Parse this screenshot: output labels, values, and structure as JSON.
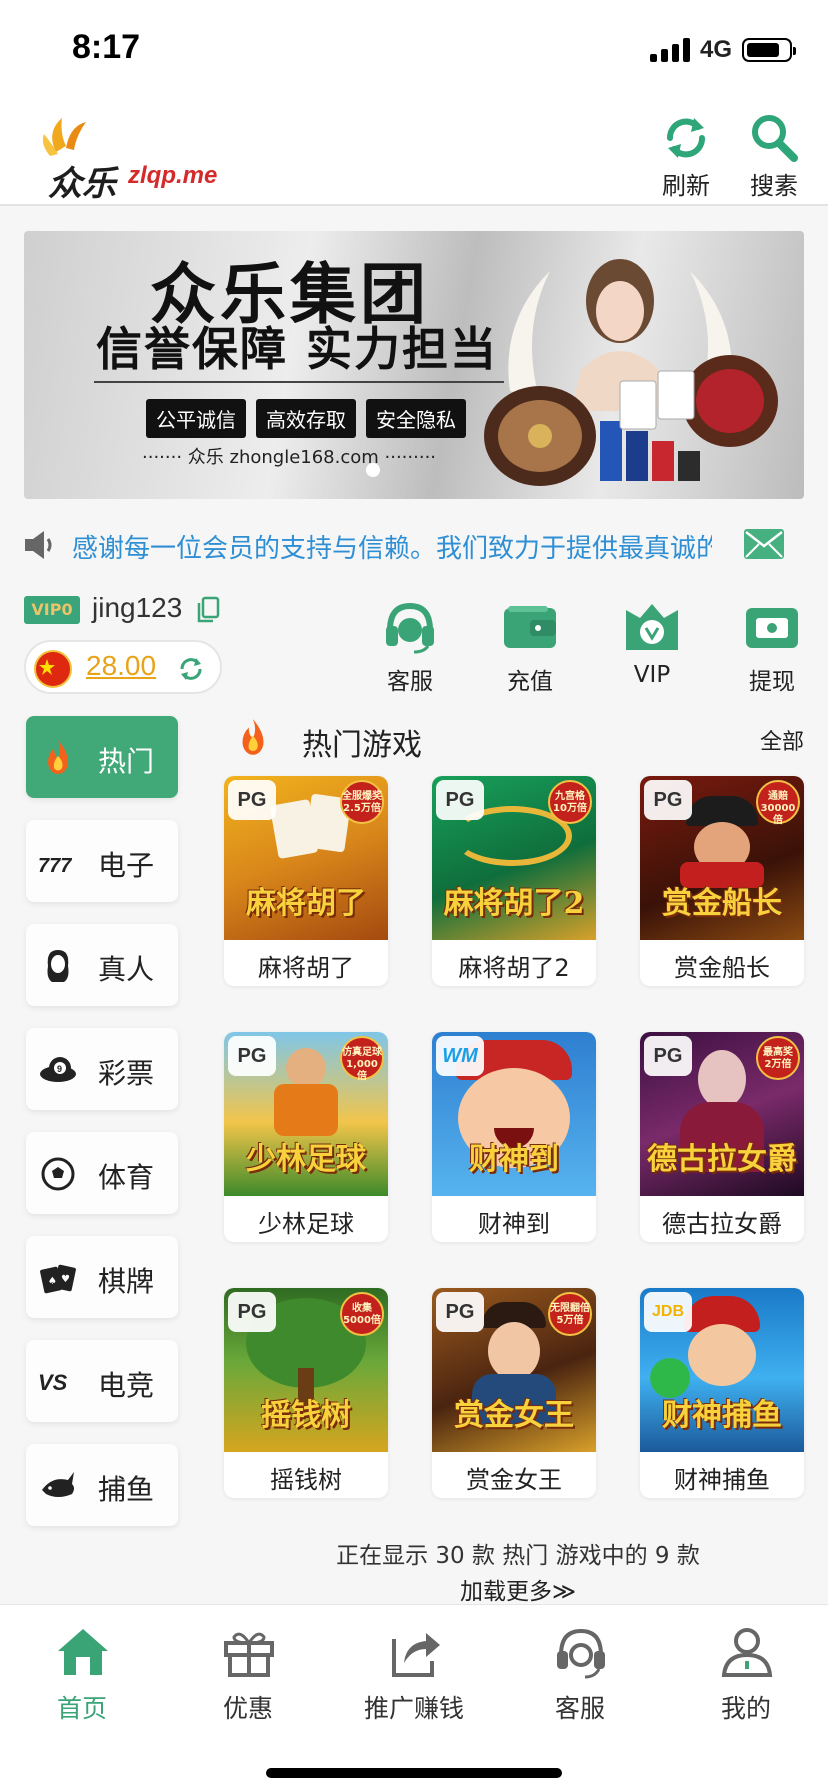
{
  "status_bar": {
    "time": "8:17",
    "network": "4G",
    "battery_fraction": 0.8
  },
  "header": {
    "logo_cn": "众乐",
    "logo_en": "zlqp.me",
    "refresh_label": "刷新",
    "search_label": "搜素"
  },
  "banner": {
    "title": "众乐集团",
    "subtitle": "信誉保障 实力担当",
    "tags": [
      "公平诚信",
      "高效存取",
      "安全隐私"
    ],
    "url": "······· 众乐 zhongle168.com ·········"
  },
  "notice": {
    "text": "感谢每一位会员的支持与信赖。我们致力于提供最真诚的"
  },
  "user": {
    "vip_level": "VIP0",
    "username": "jing123",
    "balance": "28.00"
  },
  "quick_actions": [
    {
      "label": "客服",
      "icon": "headset-icon"
    },
    {
      "label": "充值",
      "icon": "wallet-icon"
    },
    {
      "label": "VIP",
      "icon": "vip-crown-icon"
    },
    {
      "label": "提现",
      "icon": "withdraw-icon"
    }
  ],
  "sidebar": {
    "items": [
      {
        "label": "热门",
        "icon": "fire-icon",
        "active": true
      },
      {
        "label": "电子",
        "icon": "slot-777-icon"
      },
      {
        "label": "真人",
        "icon": "live-dealer-icon"
      },
      {
        "label": "彩票",
        "icon": "lottery-ball-icon"
      },
      {
        "label": "体育",
        "icon": "soccer-ball-icon"
      },
      {
        "label": "棋牌",
        "icon": "playing-cards-icon"
      },
      {
        "label": "电竞",
        "icon": "vs-icon"
      },
      {
        "label": "捕鱼",
        "icon": "shark-icon"
      }
    ]
  },
  "games_section": {
    "title": "热门游戏",
    "all_label": "全部",
    "games": [
      {
        "name": "麻将胡了",
        "provider": "PG",
        "thumb_text": "麻将胡了",
        "badge": "全服爆奖 2.5万倍"
      },
      {
        "name": "麻将胡了2",
        "provider": "PG",
        "thumb_text": "麻将胡了2",
        "badge": "九宫格 10万倍"
      },
      {
        "name": "赏金船长",
        "provider": "PG",
        "thumb_text": "赏金船长",
        "badge": "通赔 30000倍"
      },
      {
        "name": "少林足球",
        "provider": "PG",
        "thumb_text": "少林足球",
        "badge": "仿真足球 1,000倍"
      },
      {
        "name": "财神到",
        "provider": "WM",
        "thumb_text": "财神到",
        "badge": ""
      },
      {
        "name": "德古拉女爵",
        "provider": "PG",
        "thumb_text": "德古拉女爵",
        "badge": "最高奖 2万倍"
      },
      {
        "name": "摇钱树",
        "provider": "PG",
        "thumb_text": "摇钱树",
        "badge": "收集 5000倍"
      },
      {
        "name": "赏金女王",
        "provider": "PG",
        "thumb_text": "赏金女王",
        "badge": "无限翻倍 5万倍"
      },
      {
        "name": "财神捕鱼",
        "provider": "JDB",
        "thumb_text": "财神捕鱼",
        "badge": ""
      }
    ],
    "count_text": "正在显示 30 款 热门 游戏中的 9 款",
    "load_more": "加载更多≫"
  },
  "bottom_nav": {
    "items": [
      {
        "label": "首页",
        "icon": "home-icon",
        "active": true
      },
      {
        "label": "优惠",
        "icon": "gift-icon"
      },
      {
        "label": "推广赚钱",
        "icon": "share-icon"
      },
      {
        "label": "客服",
        "icon": "headset-icon"
      },
      {
        "label": "我的",
        "icon": "user-icon"
      }
    ]
  },
  "colors": {
    "brand_green": "#41a878",
    "accent_gold": "#e9a319",
    "notice_blue": "#2f8fd5"
  }
}
